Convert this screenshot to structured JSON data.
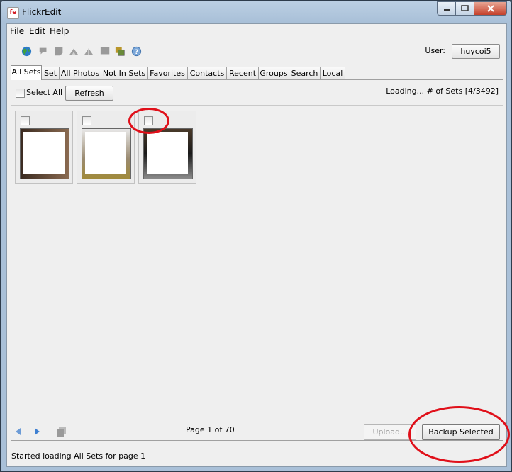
{
  "window": {
    "title": "FlickrEdit",
    "app_icon_text": "fe"
  },
  "menu": [
    "File",
    "Edit",
    "Help"
  ],
  "toolbar": {
    "icons": [
      "globe-icon",
      "speech-bubble-icon",
      "note-icon",
      "upload-set-icon",
      "download-set-icon",
      "comment-icon",
      "photos-icon",
      "help-icon"
    ],
    "user_label": "User:",
    "user_value": "huycoi5"
  },
  "tabs": [
    "All Sets",
    "Set",
    "All Photos",
    "Not In Sets",
    "Favorites",
    "Contacts",
    "Recent",
    "Groups",
    "Search",
    "Local"
  ],
  "panel": {
    "select_all_label": "Select All",
    "refresh_label": "Refresh",
    "status": "Loading...  # of Sets [4/3492]",
    "sets": [
      {
        "checked": false
      },
      {
        "checked": false
      },
      {
        "checked": false
      }
    ]
  },
  "pager": {
    "page_label": "Page 1 of 70"
  },
  "actions": {
    "upload_label": "Upload...",
    "backup_label": "Backup Selected"
  },
  "statusbar": {
    "text": "Started loading All Sets for page 1"
  },
  "colors": {
    "annotation": "#e0101a",
    "title_bar": "#a9c0d8",
    "nav_arrow": "#5b8fd0"
  }
}
